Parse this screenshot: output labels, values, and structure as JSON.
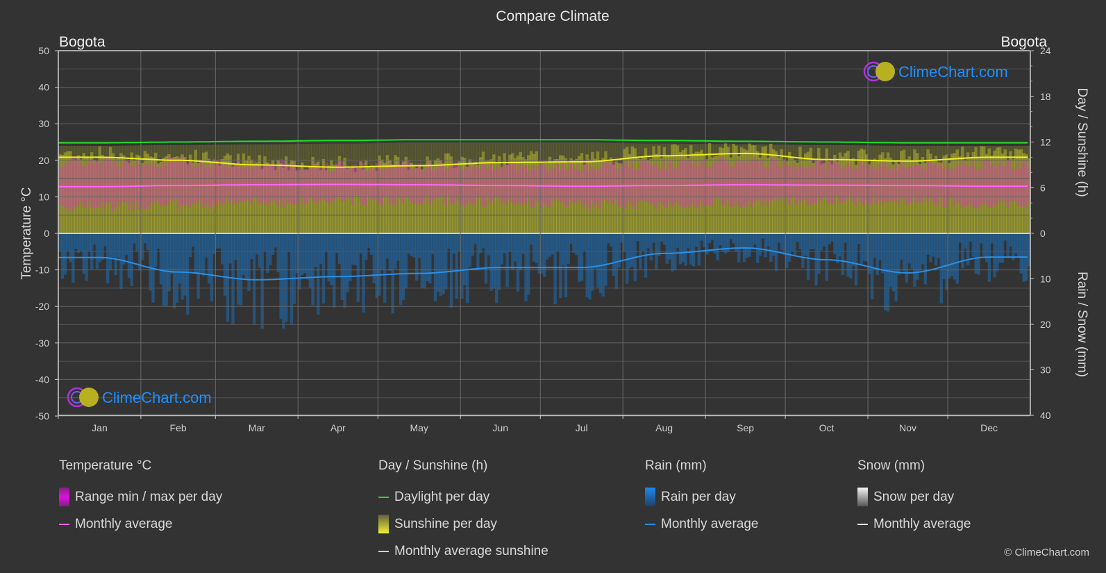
{
  "title": "Compare Climate",
  "location_left": "Bogota",
  "location_right": "Bogota",
  "watermark": "ClimeChart.com",
  "copyright": "© ClimeChart.com",
  "colors": {
    "background": "#333333",
    "grid": "#5a5a5a",
    "temp_range": "#e020e0",
    "temp_avg": "#ff66ff",
    "daylight": "#22dd22",
    "sunshine": "#c8c820",
    "sunshine_avg": "#f0f020",
    "rain": "#1e78c8",
    "rain_avg": "#2a90e8",
    "snow": "#ffffff",
    "brand": "#1e90ff"
  },
  "chart_data": {
    "type": "area",
    "title": "Compare Climate",
    "categories": [
      "Jan",
      "Feb",
      "Mar",
      "Apr",
      "May",
      "Jun",
      "Jul",
      "Aug",
      "Sep",
      "Oct",
      "Nov",
      "Dec"
    ],
    "axes": {
      "left": {
        "label": "Temperature °C",
        "range": [
          -50,
          50
        ],
        "ticks": [
          50,
          40,
          30,
          20,
          10,
          0,
          -10,
          -20,
          -30,
          -40,
          -50
        ]
      },
      "right_top": {
        "label": "Day / Sunshine (h)",
        "range": [
          0,
          24
        ],
        "ticks": [
          24,
          18,
          12,
          6,
          0
        ]
      },
      "right_bottom": {
        "label": "Rain / Snow (mm)",
        "range": [
          0,
          40
        ],
        "ticks": [
          0,
          10,
          20,
          30,
          40
        ]
      }
    },
    "grid": true,
    "series": [
      {
        "name": "Temperature monthly average",
        "unit": "°C",
        "values": [
          12.8,
          13.1,
          13.3,
          13.4,
          13.3,
          13.1,
          12.9,
          13.1,
          13.3,
          13.2,
          13.1,
          12.9
        ]
      },
      {
        "name": "Temperature range min",
        "unit": "°C",
        "values": [
          7.5,
          8.0,
          8.5,
          9.0,
          9.0,
          8.5,
          8.0,
          8.0,
          8.5,
          9.0,
          9.0,
          8.0
        ]
      },
      {
        "name": "Temperature range max",
        "unit": "°C",
        "values": [
          19.5,
          19.5,
          19.0,
          18.5,
          18.5,
          18.5,
          18.5,
          19.0,
          19.5,
          19.0,
          18.5,
          19.0
        ]
      },
      {
        "name": "Daylight per day",
        "unit": "h",
        "values": [
          11.9,
          12.0,
          12.1,
          12.2,
          12.3,
          12.3,
          12.3,
          12.2,
          12.1,
          12.0,
          11.9,
          11.9
        ]
      },
      {
        "name": "Monthly average sunshine",
        "unit": "h",
        "values": [
          10.0,
          9.6,
          9.0,
          8.7,
          8.9,
          9.3,
          9.4,
          10.2,
          10.5,
          9.7,
          9.5,
          10.0
        ]
      },
      {
        "name": "Rain monthly average",
        "unit": "mm",
        "values": [
          5.3,
          8.5,
          10.2,
          9.5,
          8.8,
          7.5,
          7.5,
          4.4,
          3.2,
          5.8,
          8.7,
          5.2
        ]
      },
      {
        "name": "Snow monthly average",
        "unit": "mm",
        "values": [
          0,
          0,
          0,
          0,
          0,
          0,
          0,
          0,
          0,
          0,
          0,
          0
        ]
      }
    ]
  },
  "legend": {
    "temperature": {
      "title": "Temperature °C",
      "items": [
        "Range min / max per day",
        "Monthly average"
      ]
    },
    "sunshine": {
      "title": "Day / Sunshine (h)",
      "items": [
        "Daylight per day",
        "Sunshine per day",
        "Monthly average sunshine"
      ]
    },
    "rain": {
      "title": "Rain (mm)",
      "items": [
        "Rain per day",
        "Monthly average"
      ]
    },
    "snow": {
      "title": "Snow (mm)",
      "items": [
        "Snow per day",
        "Monthly average"
      ]
    }
  }
}
